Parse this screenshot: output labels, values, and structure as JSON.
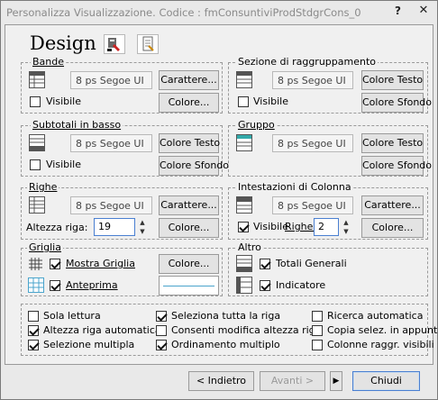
{
  "window": {
    "title": "Personalizza Visualizzazione. Codice : fmConsuntiviProdStdgrCons_0",
    "help_label": "?",
    "close_label": "✕"
  },
  "header": {
    "title": "Design"
  },
  "bande": {
    "legend": "Bande",
    "font": "8 ps Segoe UI",
    "btn_font": "Carattere...",
    "visible_label": "Visibile",
    "visible_checked": false,
    "btn_color": "Colore..."
  },
  "sezione": {
    "legend": "Sezione di raggruppamento",
    "font": "8 ps Segoe UI",
    "btn_text_color": "Colore Testo",
    "visible_label": "Visibile",
    "visible_checked": false,
    "btn_bg_color": "Colore Sfondo"
  },
  "subtotali": {
    "legend": "Subtotali in basso",
    "font": "8 ps Segoe UI",
    "btn_text_color": "Colore Testo",
    "visible_label": "Visibile",
    "visible_checked": false,
    "btn_bg_color": "Colore Sfondo"
  },
  "gruppo": {
    "legend": "Gruppo",
    "font": "8 ps Segoe UI",
    "btn_text_color": "Colore Testo",
    "btn_bg_color": "Colore Sfondo"
  },
  "righe": {
    "legend": "Righe",
    "font": "8 ps Segoe UI",
    "btn_font": "Carattere...",
    "height_label": "Altezza riga:",
    "height_value": "19",
    "btn_color": "Colore..."
  },
  "intestazioni": {
    "legend": "Intestazioni di Colonna",
    "font": "8 ps Segoe UI",
    "btn_font": "Carattere...",
    "visible_label": "Visibile",
    "visible_checked": true,
    "rows_label": "Righe:",
    "rows_value": "2",
    "btn_color": "Colore..."
  },
  "griglia": {
    "legend": "Griglia",
    "show_grid_label": "Mostra Griglia",
    "show_grid_checked": true,
    "btn_color": "Colore...",
    "preview_label": "Anteprima",
    "preview_checked": true
  },
  "altro": {
    "legend": "Altro",
    "totals_label": "Totali Generali",
    "totals_checked": true,
    "indicator_label": "Indicatore",
    "indicator_checked": true
  },
  "options": [
    {
      "label": "Sola lettura",
      "checked": false
    },
    {
      "label": "Seleziona tutta la riga",
      "checked": true
    },
    {
      "label": "Ricerca automatica",
      "checked": false
    },
    {
      "label": "Altezza riga automatica",
      "checked": true
    },
    {
      "label": "Consenti modifica altezza riga",
      "checked": false
    },
    {
      "label": "Copia selez. in appunti",
      "checked": false
    },
    {
      "label": "Selezione multipla",
      "checked": true
    },
    {
      "label": "Ordinamento multiplo",
      "checked": true
    },
    {
      "label": "Colonne raggr. visibili",
      "checked": false
    }
  ],
  "footer": {
    "back_label": "< Indietro",
    "next_label": "Avanti >",
    "play_label": "▶",
    "close_label": "Chiudi"
  },
  "colors": {
    "accent": "#4a7fd1",
    "preview_line": "#4aa4cc"
  }
}
